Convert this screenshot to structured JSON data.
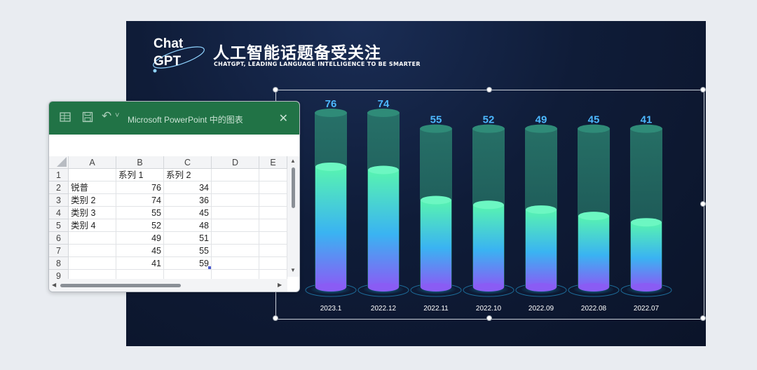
{
  "slide": {
    "logo": {
      "line1": "Chat",
      "line2": "GPT"
    },
    "title": "人工智能话题备受关注",
    "subtitle": "CHATGPT, LEADING LANGUAGE INTELLIGENCE TO BE SMARTER"
  },
  "chart_data": {
    "type": "bar",
    "categories": [
      "2023.1",
      "2022.12",
      "2022.11",
      "2022.10",
      "2022.09",
      "2022.08",
      "2022.07"
    ],
    "series": [
      {
        "values": [
          76,
          74,
          55,
          52,
          49,
          45,
          41
        ]
      },
      {
        "values": [
          34,
          36,
          45,
          48,
          51,
          55,
          59
        ]
      }
    ],
    "stacked": true,
    "ylim": [
      0,
      110
    ],
    "data_labels": "series 1 above each cylinder",
    "colors": {
      "fill_top": "#58f4b0",
      "fill_mid": "#3ab3f2",
      "fill_bottom": "#8a5cf4",
      "track": "#1f6a5e",
      "label": "#4db8ff"
    }
  },
  "excel": {
    "window_title": "Microsoft PowerPoint 中的图表",
    "icons": [
      "excel-icon",
      "save-icon",
      "undo-icon",
      "close-icon"
    ],
    "close_glyph": "✕",
    "undo_glyph": "↶",
    "dropdown_glyph": "˅",
    "column_headers": [
      "A",
      "B",
      "C",
      "D",
      "E"
    ],
    "row_headers": [
      "1",
      "2",
      "3",
      "4",
      "5",
      "6",
      "7",
      "8",
      "9"
    ],
    "rows": [
      [
        "",
        "系列 1",
        "系列 2",
        "",
        ""
      ],
      [
        "锐普",
        "76",
        "34",
        "",
        ""
      ],
      [
        "类别 2",
        "74",
        "36",
        "",
        ""
      ],
      [
        "类别 3",
        "55",
        "45",
        "",
        ""
      ],
      [
        "类别 4",
        "52",
        "48",
        "",
        ""
      ],
      [
        "",
        "49",
        "51",
        "",
        ""
      ],
      [
        "",
        "45",
        "55",
        "",
        ""
      ],
      [
        "",
        "41",
        "59",
        "",
        ""
      ],
      [
        "",
        "",
        "",
        "",
        ""
      ]
    ]
  }
}
